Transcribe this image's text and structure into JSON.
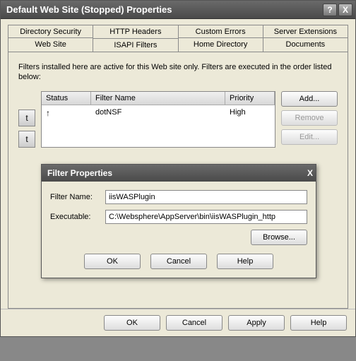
{
  "window": {
    "title": "Default Web Site (Stopped) Properties",
    "help_btn": "?",
    "close_btn": "X"
  },
  "tabs": {
    "row1": [
      "Directory Security",
      "HTTP Headers",
      "Custom Errors",
      "Server Extensions"
    ],
    "row2": [
      "Web Site",
      "ISAPI Filters",
      "Home Directory",
      "Documents"
    ],
    "active": "ISAPI Filters"
  },
  "panel": {
    "description": "Filters installed here are active for this Web site only. Filters are executed in the order listed below:",
    "columns": {
      "status": "Status",
      "name": "Filter Name",
      "priority": "Priority"
    },
    "rows": [
      {
        "status_icon": "↑",
        "name": "dotNSF",
        "priority": "High"
      }
    ],
    "buttons": {
      "add": "Add...",
      "remove": "Remove",
      "edit": "Edit..."
    }
  },
  "bottom": {
    "ok": "OK",
    "cancel": "Cancel",
    "apply": "Apply",
    "help": "Help"
  },
  "dialog": {
    "title": "Filter Properties",
    "close": "X",
    "filter_name_label": "Filter Name:",
    "filter_name_value": "iisWASPlugin",
    "exec_label": "Executable:",
    "exec_value": "C:\\Websphere\\AppServer\\bin\\iisWASPlugin_http",
    "browse": "Browse...",
    "ok": "OK",
    "cancel": "Cancel",
    "help": "Help"
  }
}
